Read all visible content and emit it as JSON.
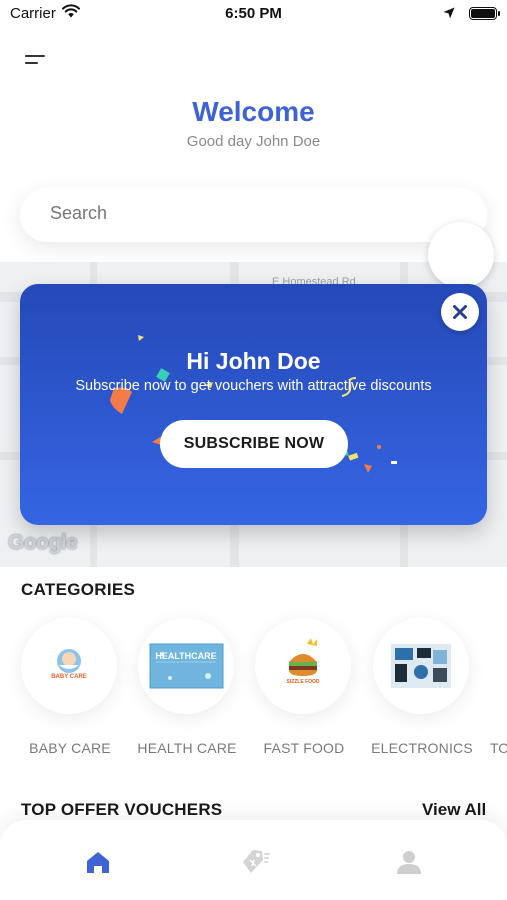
{
  "status_bar": {
    "carrier": "Carrier",
    "time": "6:50 PM"
  },
  "header": {
    "title": "Welcome",
    "greeting": "Good day John Doe"
  },
  "search": {
    "placeholder": "Search"
  },
  "map": {
    "street_label": "E Homestead Rd",
    "provider_logo": "Google"
  },
  "popup": {
    "title": "Hi John Doe",
    "message": "Subscribe now to get vouchers with attractive discounts",
    "subscribe_label": "SUBSCRIBE NOW",
    "close_icon": "close-icon"
  },
  "categories": {
    "heading": "CATEGORIES",
    "items": [
      {
        "label": "BABY CARE",
        "image_text": "BABY CARE"
      },
      {
        "label": "HEALTH CARE",
        "image_text": "HEALTHCARE"
      },
      {
        "label": "FAST FOOD",
        "image_text": "SIZZLE FOOD"
      },
      {
        "label": "ELECTRONICS"
      }
    ],
    "overflow_label": "TO"
  },
  "offers": {
    "heading": "TOP OFFER VOUCHERS",
    "view_all_label": "View All"
  },
  "tab_bar": {
    "tabs": [
      {
        "icon": "home-icon",
        "active": true
      },
      {
        "icon": "voucher-tag-icon",
        "active": false
      },
      {
        "icon": "profile-icon",
        "active": false
      }
    ]
  },
  "colors": {
    "accent": "#3f63d6",
    "popup_top": "#2549b8",
    "popup_bottom": "#3565e3",
    "muted_text": "#8a8a8a",
    "inactive_icon": "#cfcfcf"
  }
}
